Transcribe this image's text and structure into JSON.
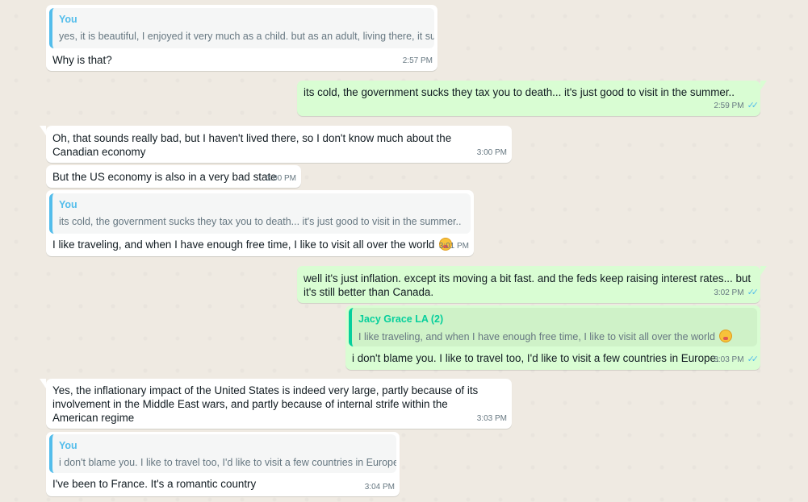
{
  "messages": [
    {
      "quote_name": "You",
      "quote_text": "yes, it is beautiful, I enjoyed it very much as a child.  but as an adult, living there, it sucks",
      "text": "Why is that?",
      "time": "2:57 PM"
    },
    {
      "text": "its cold, the government sucks they tax you to death...   it's just good to visit in the summer..",
      "time": "2:59 PM",
      "ticks": "✓✓"
    },
    {
      "text": "Oh, that sounds really bad, but I haven't lived there, so I don't know much about the Canadian economy",
      "time": "3:00 PM"
    },
    {
      "text": "But the US economy is also in a very bad state",
      "time": "3:00 PM"
    },
    {
      "quote_name": "You",
      "quote_text": "its cold, the government sucks they tax you to death...   it's just good to visit in the summer..",
      "text": "I like traveling, and when I have enough free time, I like to visit all over the world",
      "emoji": "face-with-hand-over-mouth",
      "time": "3:01 PM"
    },
    {
      "text": "well it's just inflation.  except its moving a bit fast. and the feds keep raising interest rates... but it's still better than Canada.",
      "time": "3:02 PM",
      "ticks": "✓✓"
    },
    {
      "quote_name": "Jacy Grace LA (2)",
      "quote_text": "I like traveling, and when I have enough free time, I like to visit all over the world",
      "emoji": "face-with-hand-over-mouth",
      "text": "i don't blame you.   I like to travel too, I'd like to visit a few countries in Europe.",
      "time": "3:03 PM",
      "ticks": "✓✓"
    },
    {
      "text": "Yes, the inflationary impact of the United States is indeed very large, partly because of its involvement in the Middle East wars, and partly because of internal strife within the American regime",
      "time": "3:03 PM"
    },
    {
      "quote_name": "You",
      "quote_text": "i don't blame you.   I like to travel too, I'd like to visit a few countries in Europe.",
      "text": "I've been to France. It's a romantic country",
      "time": "3:04 PM"
    }
  ],
  "colors": {
    "incoming": "#ffffff",
    "outgoing": "#d9fdd3",
    "background": "#efeae2",
    "read_ticks": "#53bdeb",
    "quote_you": "#53bdeb",
    "quote_contact": "#06cf9c"
  }
}
